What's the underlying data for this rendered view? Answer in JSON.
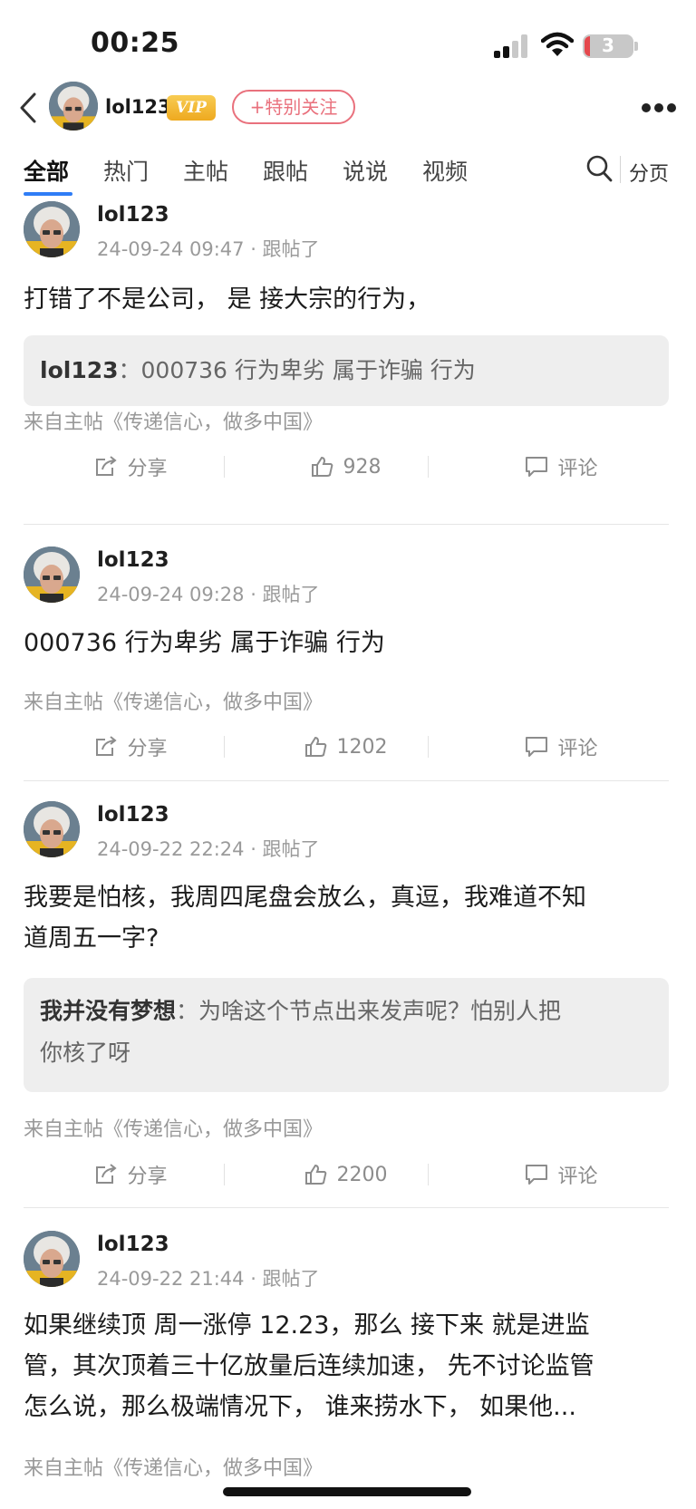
{
  "status_bar": {
    "time": "00:25",
    "battery_level": "3"
  },
  "header": {
    "username": "lol123",
    "vip_label": "VIP",
    "follow_label": "+特别关注"
  },
  "tabs": [
    {
      "label": "全部",
      "active": true
    },
    {
      "label": "热门",
      "active": false
    },
    {
      "label": "主帖",
      "active": false
    },
    {
      "label": "跟帖",
      "active": false
    },
    {
      "label": "说说",
      "active": false
    },
    {
      "label": "视频",
      "active": false
    }
  ],
  "page_label": "分页",
  "posts": [
    {
      "username": "lol123",
      "meta": "24-09-24 09:47 · 跟帖了",
      "body_lines": [
        "打错了不是公司， 是 接大宗的行为，"
      ],
      "quote": {
        "user": "lol123",
        "separator": "：",
        "lines": [
          "000736 行为卑劣 属于诈骗 行为"
        ]
      },
      "source": "来自主帖《传递信心，做多中国》",
      "share_label": "分享",
      "likes": "928",
      "comment_label": "评论"
    },
    {
      "username": "lol123",
      "meta": "24-09-24 09:28 · 跟帖了",
      "body_lines": [
        "000736 行为卑劣 属于诈骗 行为"
      ],
      "quote": null,
      "source": "来自主帖《传递信心，做多中国》",
      "share_label": "分享",
      "likes": "1202",
      "comment_label": "评论"
    },
    {
      "username": "lol123",
      "meta": "24-09-22 22:24 · 跟帖了",
      "body_lines": [
        "我要是怕核，我周四尾盘会放么，真逗，我难道不知",
        "道周五一字?"
      ],
      "quote": {
        "user": "我并没有梦想",
        "separator": "：",
        "lines": [
          "为啥这个节点出来发声呢？怕别人把",
          "你核了呀"
        ]
      },
      "source": "来自主帖《传递信心，做多中国》",
      "share_label": "分享",
      "likes": "2200",
      "comment_label": "评论"
    },
    {
      "username": "lol123",
      "meta": "24-09-22 21:44 · 跟帖了",
      "body_lines": [
        "如果继续顶 周一涨停 12.23，那么 接下来 就是进监",
        "管，其次顶着三十亿放量后连续加速， 先不讨论监管",
        "怎么说，那么极端情况下， 谁来捞水下， 如果他..."
      ],
      "quote": null,
      "source": "来自主帖《传递信心，做多中国》"
    }
  ]
}
